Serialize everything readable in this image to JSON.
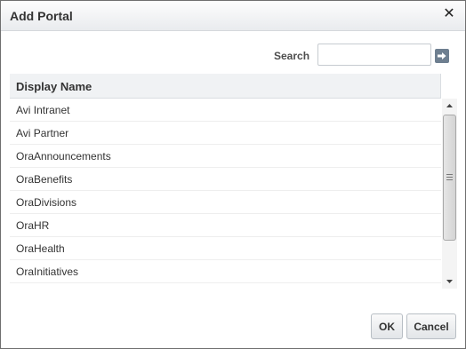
{
  "dialog": {
    "title": "Add Portal",
    "close_icon": "close-icon"
  },
  "search": {
    "label": "Search",
    "value": "",
    "placeholder": "",
    "go_icon": "arrow-right-icon"
  },
  "table": {
    "column_header": "Display Name",
    "rows": [
      {
        "label": "Avi Intranet"
      },
      {
        "label": "Avi Partner"
      },
      {
        "label": "OraAnnouncements"
      },
      {
        "label": "OraBenefits"
      },
      {
        "label": "OraDivisions"
      },
      {
        "label": "OraHR"
      },
      {
        "label": "OraHealth"
      },
      {
        "label": "OraInitiatives"
      }
    ]
  },
  "buttons": {
    "ok_label": "OK",
    "cancel_label": "Cancel"
  }
}
